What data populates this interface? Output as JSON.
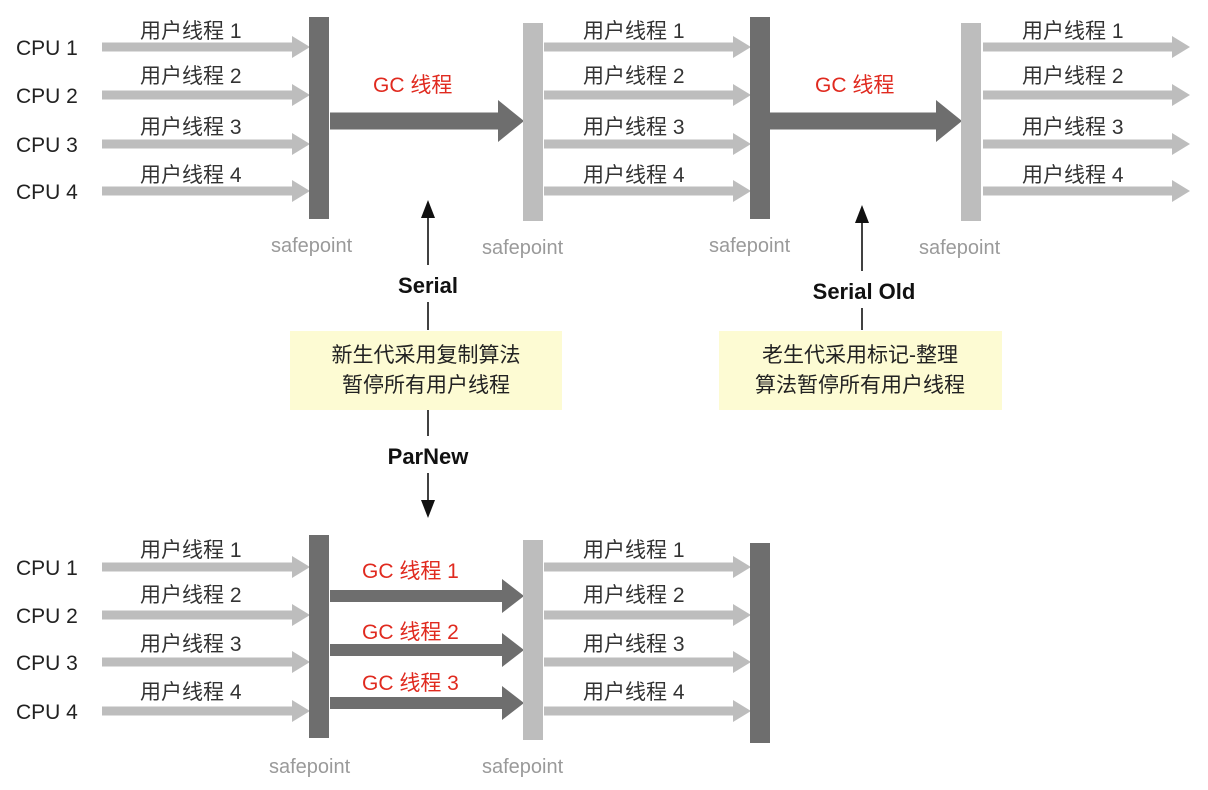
{
  "labels": {
    "safepoint": "safepoint",
    "thread_prefix": "用户线程"
  },
  "colors": {
    "user_arrow": "#bdbdbd",
    "gc_arrow": "#6e6e6e",
    "bar_dark": "#6e6e6e",
    "bar_light": "#bdbdbd",
    "gc_text": "#e02a1f",
    "note_bg": "#fdfbd3"
  },
  "cpus": [
    "CPU 1",
    "CPU 2",
    "CPU 3",
    "CPU 4"
  ],
  "threads": [
    "用户线程 1",
    "用户线程 2",
    "用户线程 3",
    "用户线程 4"
  ],
  "top": {
    "gc_label_1": "GC 线程",
    "gc_label_2": "GC 线程"
  },
  "bottom": {
    "gc_labels": [
      "GC 线程 1",
      "GC 线程 2",
      "GC 线程 3"
    ]
  },
  "collectors": {
    "serial": "Serial",
    "serial_old": "Serial Old",
    "parnew": "ParNew"
  },
  "notes": {
    "young": [
      "新生代采用复制算法",
      "暂停所有用户线程"
    ],
    "old": [
      "老生代采用标记-整理",
      "算法暂停所有用户线程"
    ]
  }
}
